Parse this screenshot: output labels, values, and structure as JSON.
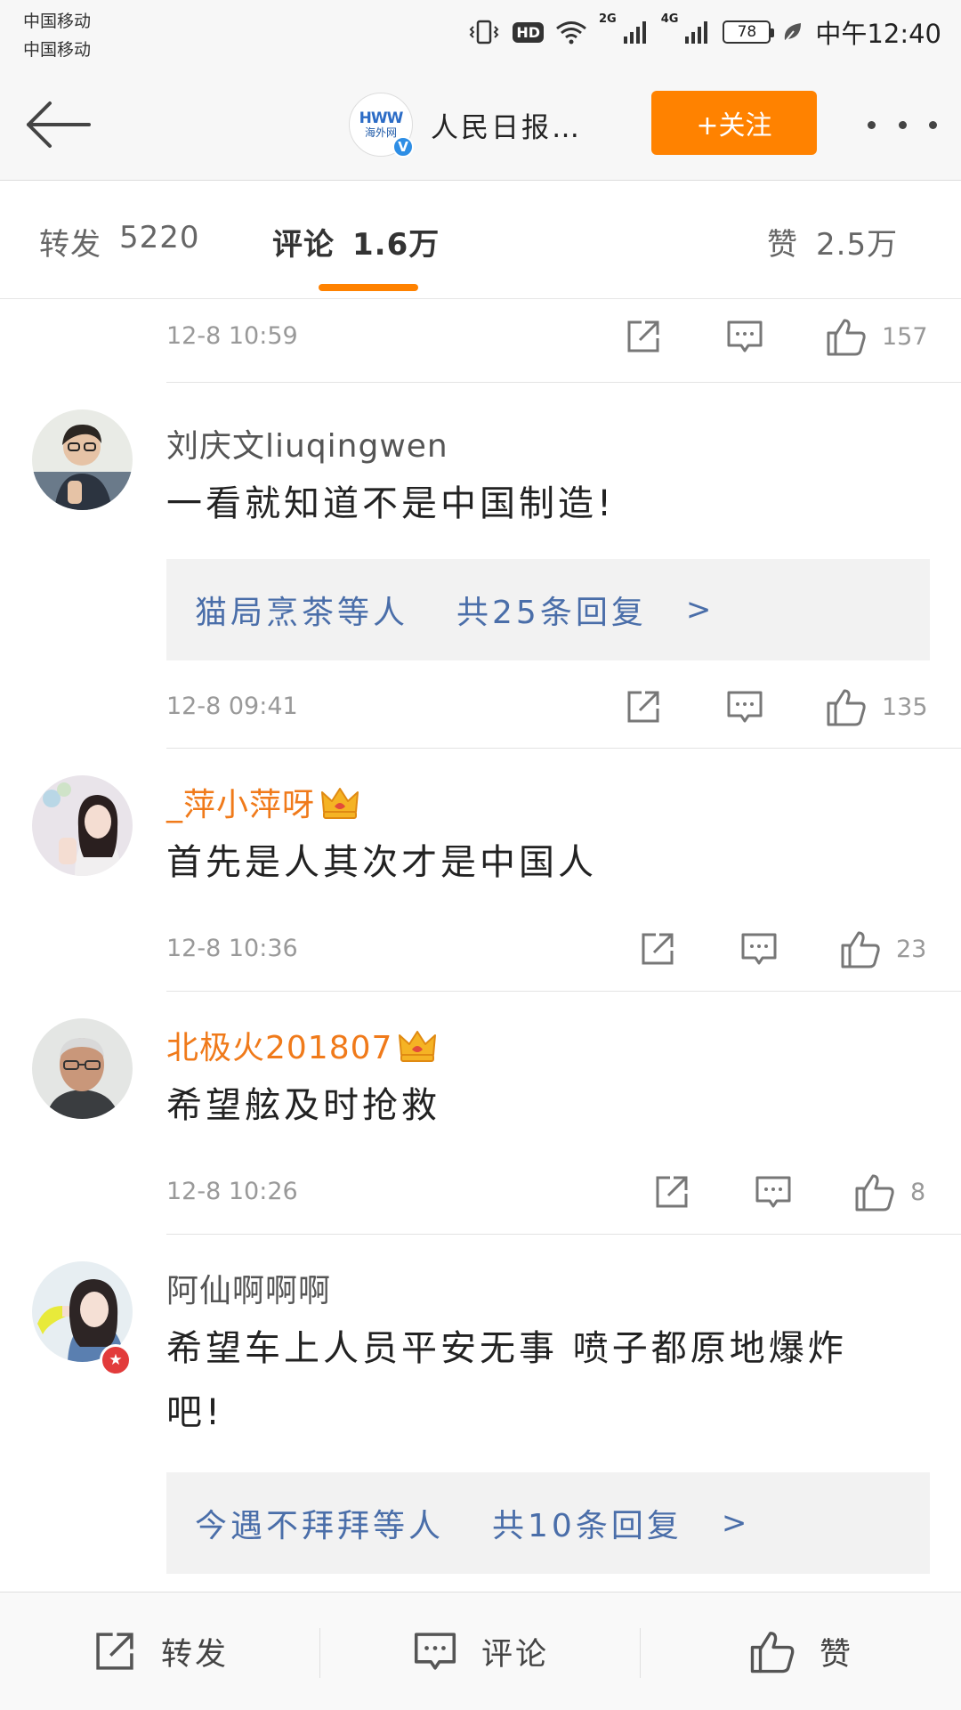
{
  "status_bar": {
    "carrier1": "中国移动",
    "carrier2": "中国移动",
    "hd": "HD",
    "net1": "2G",
    "net2": "4G",
    "battery": "78",
    "time": "中午12:40"
  },
  "header": {
    "account_logo_line1": "HWW",
    "account_logo_line2": "海外网",
    "verified": "V",
    "account_name": "人民日报…",
    "follow_label": "+关注"
  },
  "tabs": {
    "repost": {
      "label": "转发",
      "count": "5220"
    },
    "comment": {
      "label": "评论",
      "count": "1.6万"
    },
    "like": {
      "label": "赞",
      "count": "2.5万"
    }
  },
  "top_meta": {
    "time": "12-8  10:59",
    "likes": "157"
  },
  "comments": [
    {
      "user": "刘庆文liuqingwen",
      "text": "一看就知道不是中国制造!",
      "replies_by": "猫局烹茶等人",
      "replies_count": "共25条回复",
      "time": "12-8  09:41",
      "likes": "135"
    },
    {
      "user": "_萍小萍呀",
      "text": "首先是人其次才是中国人",
      "time": "12-8  10:36",
      "likes": "23"
    },
    {
      "user": "北极火201807",
      "text": "希望舷及时抢救",
      "time": "12-8  10:26",
      "likes": "8"
    },
    {
      "user": "阿仙啊啊啊",
      "text": "希望车上人员平安无事 喷子都原地爆炸吧!",
      "replies_by": "今遇不拜拜等人",
      "replies_count": "共10条回复"
    }
  ],
  "reply_chevron": ">",
  "bottom_bar": {
    "repost": "转发",
    "comment": "评论",
    "like": "赞"
  },
  "colors": {
    "accent": "#ff8200",
    "link": "#4a6ea9",
    "vip_name": "#f07a1a"
  }
}
